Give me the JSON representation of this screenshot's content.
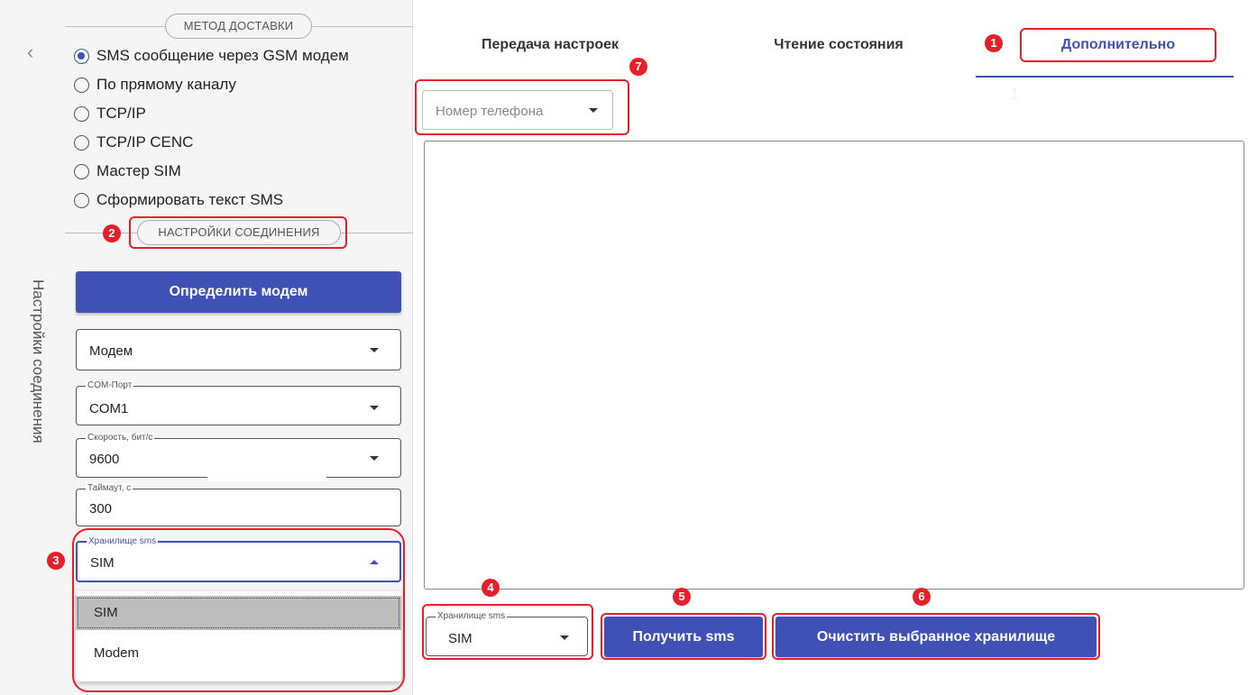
{
  "left": {
    "vertical_title": "Настройки соединения",
    "delivery_section": "МЕТОД ДОСТАВКИ",
    "delivery_options": [
      {
        "label": "SMS сообщение через GSM модем",
        "checked": true
      },
      {
        "label": "По прямому каналу",
        "checked": false
      },
      {
        "label": "TCP/IP",
        "checked": false
      },
      {
        "label": "TCP/IP CENC",
        "checked": false
      },
      {
        "label": "Мастер SIM",
        "checked": false
      },
      {
        "label": "Сформировать текст SMS",
        "checked": false
      }
    ],
    "connection_section": "НАСТРОЙКИ СОЕДИНЕНИЯ",
    "detect_modem_button": "Определить модем",
    "device_select": {
      "value": "Модем"
    },
    "com_port": {
      "label": "COM-Порт",
      "value": "COM1"
    },
    "speed": {
      "label": "Скорость, бит/с",
      "value": "9600"
    },
    "timeout": {
      "label": "Таймаут, с",
      "value": "300"
    },
    "sms_storage": {
      "label": "Хранилище sms",
      "value": "SIM"
    },
    "sms_storage_options": [
      "SIM",
      "Modem"
    ]
  },
  "tabs": [
    {
      "label": "Передача настроек",
      "active": false
    },
    {
      "label": "Чтение состояния",
      "active": false
    },
    {
      "label": "Дополнительно",
      "active": true
    }
  ],
  "faint_number": "1",
  "phone_select": {
    "placeholder": "Номер телефона"
  },
  "bottom": {
    "storage_label": "Хранилище sms",
    "storage_value": "SIM",
    "get_sms_button": "Получить sms",
    "clear_button": "Очистить выбранное хранилище"
  },
  "badges": [
    "1",
    "2",
    "3",
    "4",
    "5",
    "6",
    "7"
  ],
  "colors": {
    "accent": "#3f51b5",
    "annotation": "#e5202a",
    "panel_bg": "#f5f5f5"
  }
}
